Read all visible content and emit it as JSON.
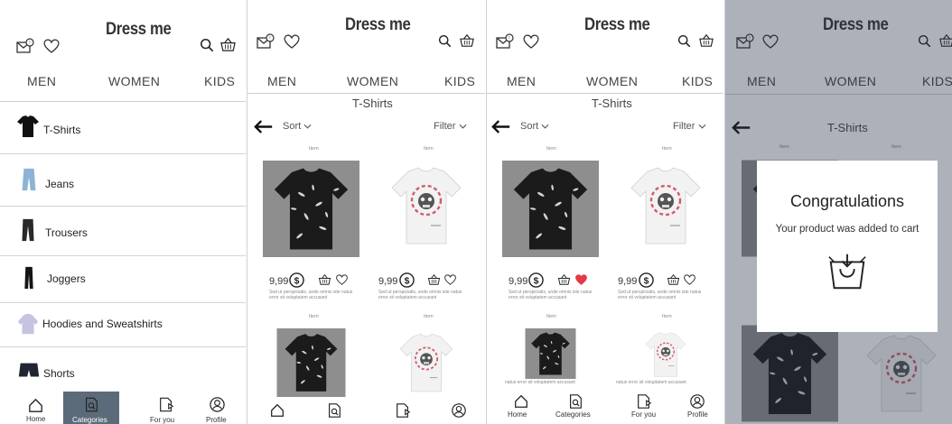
{
  "app": {
    "title": "Dress me"
  },
  "tabs": [
    "MEN",
    "WOMEN",
    "KIDS"
  ],
  "category_list": [
    {
      "label": "T-Shirts"
    },
    {
      "label": "Jeans"
    },
    {
      "label": "Trousers"
    },
    {
      "label": "Joggers"
    },
    {
      "label": "Hoodies and Sweatshirts"
    },
    {
      "label": "Shorts"
    }
  ],
  "listing": {
    "title": "T-Shirts",
    "sort_label": "Sort",
    "filter_label": "Filter",
    "item_caption": "Item",
    "price": "9,99",
    "currency_symbol": "$",
    "description": "Sed ut perspiciatis, unde omnis iste natus error sit voluptatem accusant",
    "truncated_text": "natus error sit voluptatem accusant"
  },
  "bottom_nav": [
    "Home",
    "Categories",
    "For you",
    "Profile"
  ],
  "dialog": {
    "title": "Congratulations",
    "message": "Your product was added to cart"
  },
  "colors": {
    "accent_active_tab": "#5c6b79",
    "like_active": "#e53945",
    "overlay": "#283246"
  },
  "icons": [
    "mail-icon",
    "heart-icon",
    "search-icon",
    "basket-icon",
    "back-arrow-icon",
    "dollar-icon",
    "home-icon",
    "categories-icon",
    "for-you-icon",
    "profile-icon",
    "cart-bag-icon"
  ]
}
